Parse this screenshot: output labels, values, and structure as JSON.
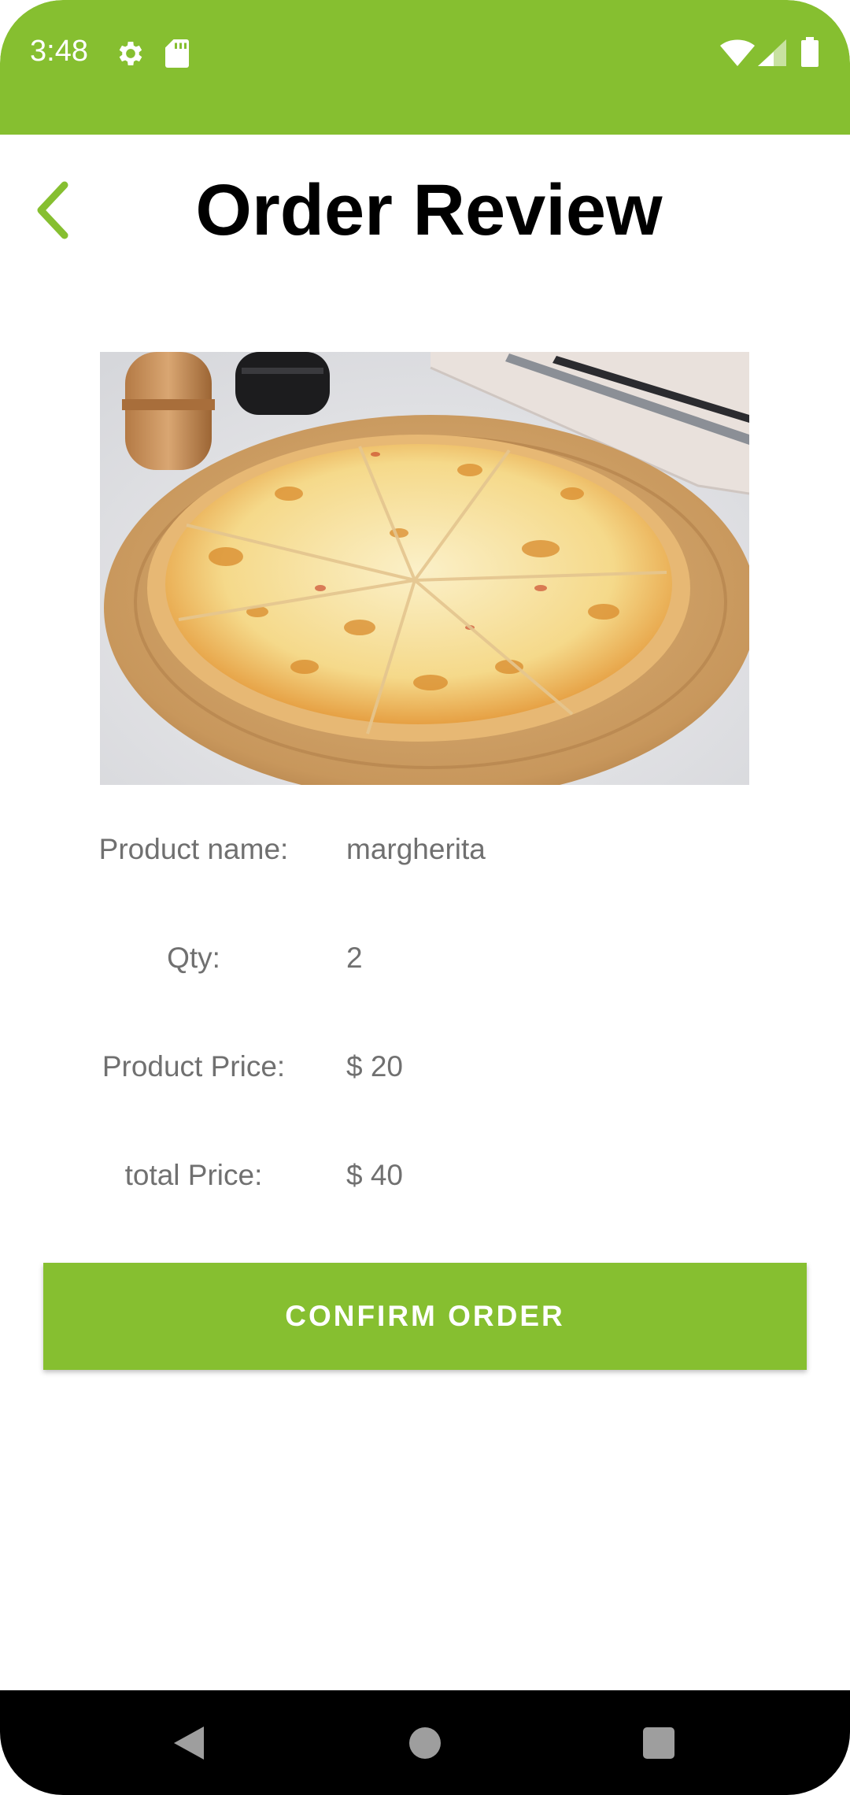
{
  "status_bar": {
    "time": "3:48",
    "icons": [
      "gear-icon",
      "sd-card-icon",
      "wifi-icon",
      "cell-signal-icon",
      "battery-icon"
    ],
    "background": "#86bf30"
  },
  "header": {
    "title": "Order Review",
    "back_icon": "chevron-left-icon",
    "accent": "#86bf30"
  },
  "product": {
    "image": "pizza-photo",
    "details": [
      {
        "label": "Product name:",
        "value": "margherita"
      },
      {
        "label": "Qty:",
        "value": "2"
      },
      {
        "label": "Product Price:",
        "value": "$ 20"
      },
      {
        "label": "total Price:",
        "value": "$ 40"
      }
    ]
  },
  "actions": {
    "confirm_label": "CONFIRM ORDER",
    "button_color": "#86bf30"
  },
  "nav_bar": {
    "icons": [
      "back-triangle-icon",
      "home-circle-icon",
      "recents-square-icon"
    ]
  }
}
